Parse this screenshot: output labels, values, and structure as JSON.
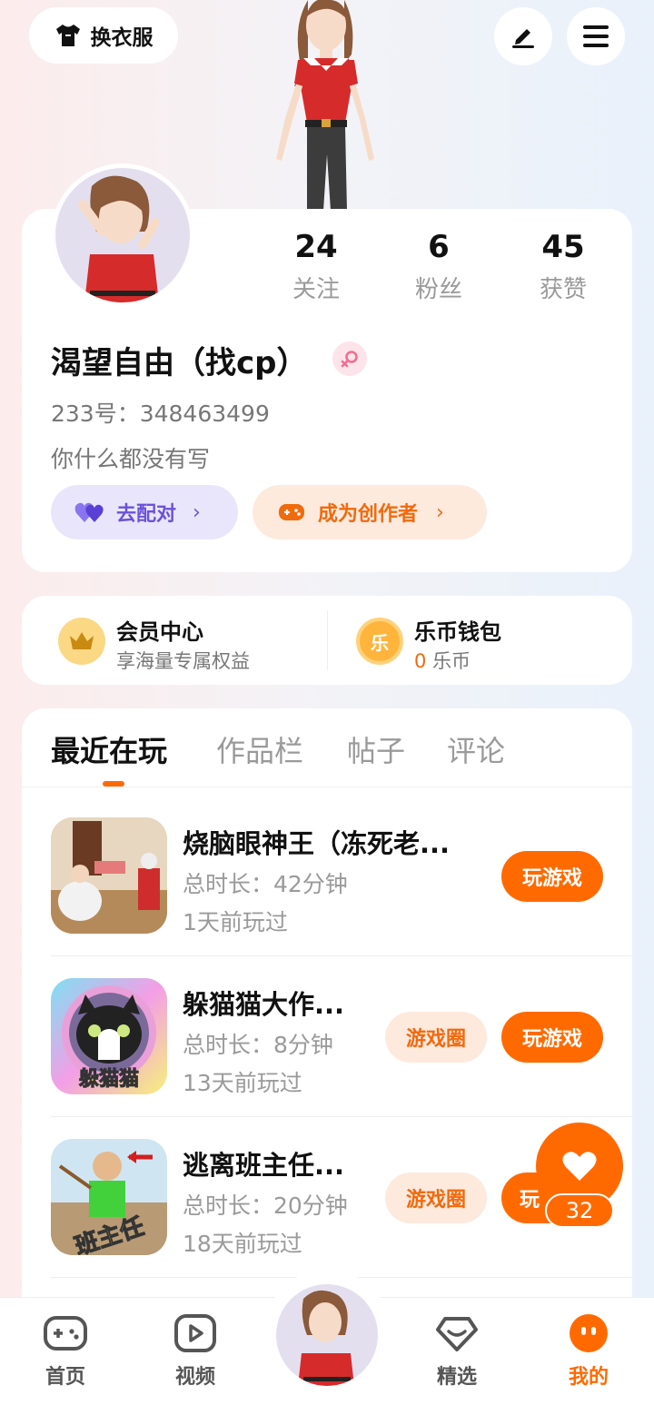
{
  "top": {
    "outfit_label": "换衣服"
  },
  "stats": [
    {
      "value": "24",
      "label": "关注"
    },
    {
      "value": "6",
      "label": "粉丝"
    },
    {
      "value": "45",
      "label": "获赞"
    }
  ],
  "profile": {
    "name": "渴望自由（找cp）",
    "id_text": "233号：348463499",
    "bio": "你什么都没有写",
    "match_label": "去配对",
    "creator_label": "成为创作者"
  },
  "member": {
    "title": "会员中心",
    "subtitle": "享海量专属权益"
  },
  "wallet": {
    "title": "乐币钱包",
    "balance": "0",
    "unit": "乐币",
    "coin_glyph": "乐"
  },
  "tabs": [
    "最近在玩",
    "作品栏",
    "帖子",
    "评论"
  ],
  "games": [
    {
      "title": "烧脑眼神王（冻死老...",
      "duration": "总时长：42分钟",
      "last_played": "1天前玩过",
      "play_label": "玩游戏"
    },
    {
      "title": "躲猫猫大作...",
      "duration": "总时长：8分钟",
      "last_played": "13天前玩过",
      "circle_label": "游戏圈",
      "play_label": "玩游戏",
      "icon_text": "躲猫猫"
    },
    {
      "title": "逃离班主任...",
      "duration": "总时长：20分钟",
      "last_played": "18天前玩过",
      "circle_label": "游戏圈",
      "play_label": "玩",
      "icon_text": "班主任"
    }
  ],
  "like_count": "32",
  "nav": [
    {
      "label": "首页"
    },
    {
      "label": "视频"
    },
    {
      "label": "精选"
    },
    {
      "label": "我的"
    }
  ],
  "colors": {
    "accent": "#ff6a00",
    "accent_light": "#fee9dd",
    "match": "#6b52d8",
    "match_bg": "#e9e6fb"
  }
}
